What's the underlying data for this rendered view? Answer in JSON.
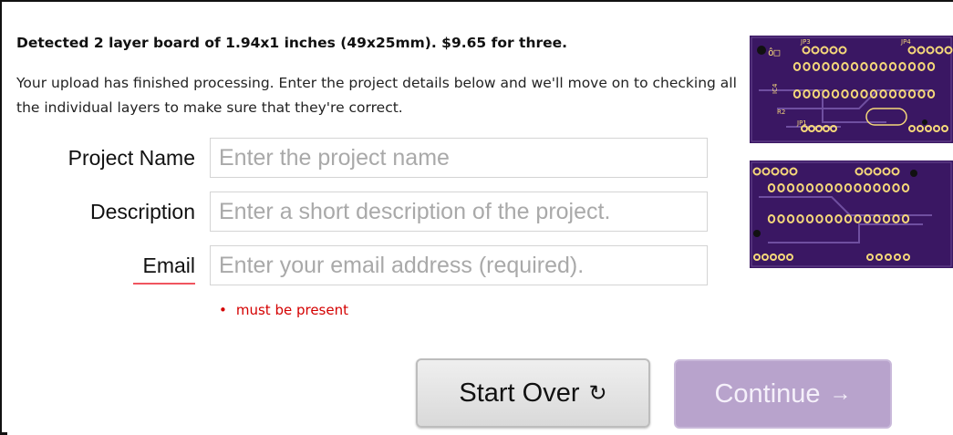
{
  "headline": "Detected 2 layer board of 1.94x1 inches (49x25mm). $9.65 for three.",
  "intro": "Your upload has finished processing. Enter the project details below and we'll move on to checking all the individual layers to make sure that they're correct.",
  "form": {
    "name": {
      "label": "Project Name",
      "value": "",
      "placeholder": "Enter the project name"
    },
    "description": {
      "label": "Description",
      "value": "",
      "placeholder": "Enter a short description of the project."
    },
    "email": {
      "label": "Email",
      "value": "",
      "placeholder": "Enter your email address (required).",
      "error": "must be present"
    }
  },
  "buttons": {
    "start_over": {
      "label": "Start Over",
      "glyph": "↻"
    },
    "continue": {
      "label": "Continue",
      "glyph": "→"
    }
  },
  "board_labels": {
    "top": [
      "JP3",
      "JP4",
      "IC4",
      "R2",
      "JP1"
    ]
  },
  "colors": {
    "board": "#3a1763",
    "pad": "#f5d87a",
    "error": "#d40000",
    "continue_bg": "#b8a3cc"
  }
}
